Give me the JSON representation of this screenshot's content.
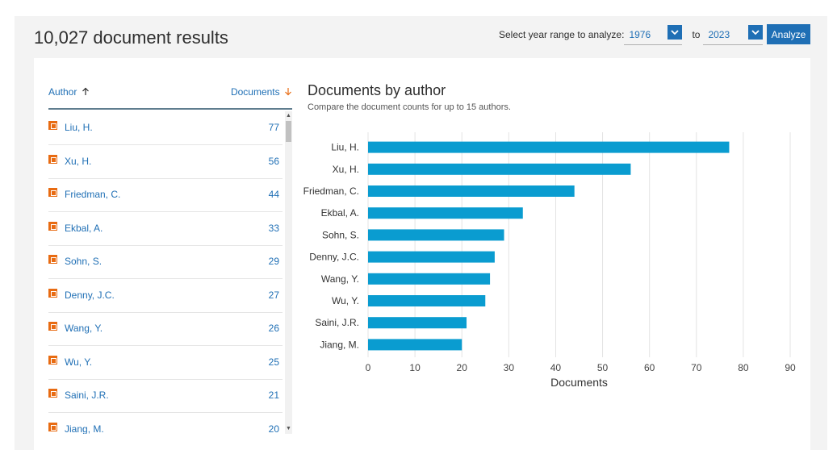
{
  "results": {
    "title": "10,027 document results"
  },
  "year_range": {
    "label": "Select year range to analyze:",
    "from": "1976",
    "to_label": "to",
    "to": "2023",
    "analyze_label": "Analyze"
  },
  "author_list": {
    "header_author": "Author",
    "header_documents": "Documents",
    "items": [
      {
        "name": "Liu, H.",
        "count": "77"
      },
      {
        "name": "Xu, H.",
        "count": "56"
      },
      {
        "name": "Friedman, C.",
        "count": "44"
      },
      {
        "name": "Ekbal, A.",
        "count": "33"
      },
      {
        "name": "Sohn, S.",
        "count": "29"
      },
      {
        "name": "Denny, J.C.",
        "count": "27"
      },
      {
        "name": "Wang, Y.",
        "count": "26"
      },
      {
        "name": "Wu, Y.",
        "count": "25"
      },
      {
        "name": "Saini, J.R.",
        "count": "21"
      },
      {
        "name": "Jiang, M.",
        "count": "20"
      }
    ]
  },
  "chart": {
    "title": "Documents by author",
    "subtitle": "Compare the document counts for up to 15 authors."
  },
  "colors": {
    "bar": "#0a9cd0",
    "accent": "#1f6fb5",
    "checkbox": "#e86b12"
  },
  "chart_data": {
    "type": "bar",
    "orientation": "horizontal",
    "categories": [
      "Liu, H.",
      "Xu, H.",
      "Friedman, C.",
      "Ekbal, A.",
      "Sohn, S.",
      "Denny, J.C.",
      "Wang, Y.",
      "Wu, Y.",
      "Saini, J.R.",
      "Jiang, M."
    ],
    "values": [
      77,
      56,
      44,
      33,
      29,
      27,
      26,
      25,
      21,
      20
    ],
    "xlabel": "Documents",
    "ylabel": "",
    "xlim": [
      0,
      90
    ],
    "xticks": [
      "0",
      "10",
      "20",
      "30",
      "40",
      "50",
      "60",
      "70",
      "80",
      "90"
    ],
    "grid": "vertical"
  }
}
